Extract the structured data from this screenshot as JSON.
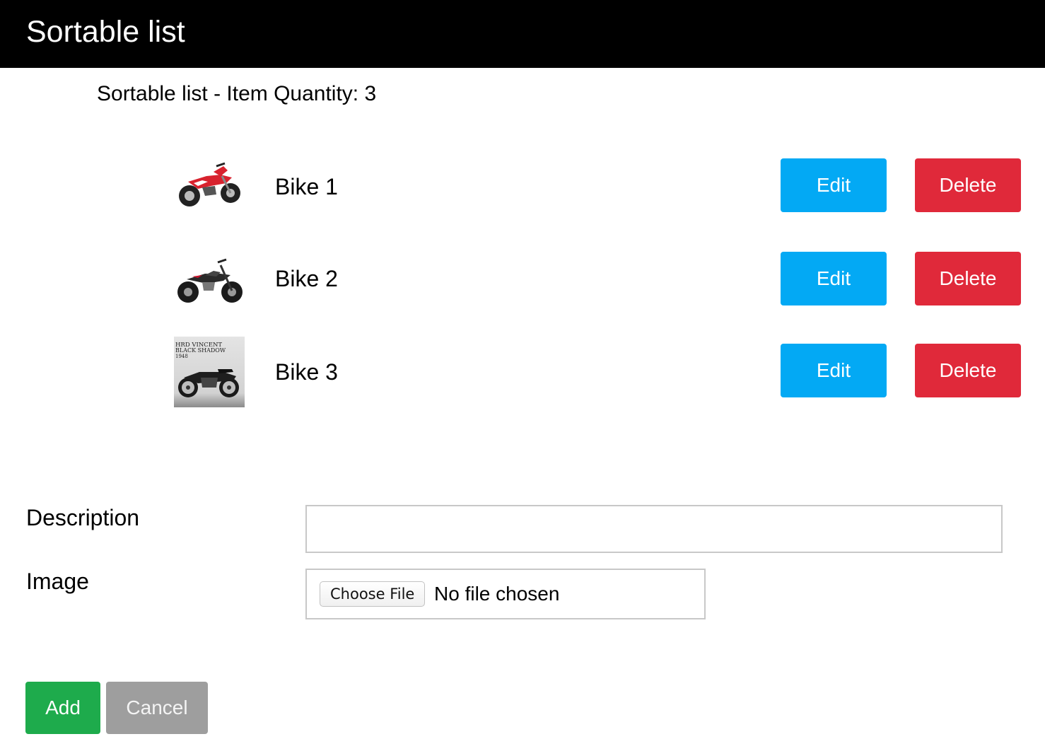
{
  "header": {
    "title": "Sortable list"
  },
  "summary": {
    "text": "Sortable list - Item Quantity: 3"
  },
  "items": [
    {
      "label": "Bike 1",
      "image": "red-dirt-bike-image",
      "edit_label": "Edit",
      "delete_label": "Delete"
    },
    {
      "label": "Bike 2",
      "image": "black-pit-bike-image",
      "edit_label": "Edit",
      "delete_label": "Delete"
    },
    {
      "label": "Bike 3",
      "image": "vintage-motorcycle-kit-box-image",
      "cover_lines": [
        "HRD VINCENT",
        "BLACK SHADOW",
        "1948"
      ],
      "edit_label": "Edit",
      "delete_label": "Delete"
    }
  ],
  "form": {
    "description_label": "Description",
    "description_value": "",
    "image_label": "Image",
    "choose_file_label": "Choose File",
    "file_status": "No file chosen",
    "add_label": "Add",
    "cancel_label": "Cancel"
  },
  "colors": {
    "header_bg": "#000000",
    "edit": "#03a9f4",
    "delete": "#e0293a",
    "add": "#1eab4c",
    "cancel": "#9e9e9e"
  }
}
